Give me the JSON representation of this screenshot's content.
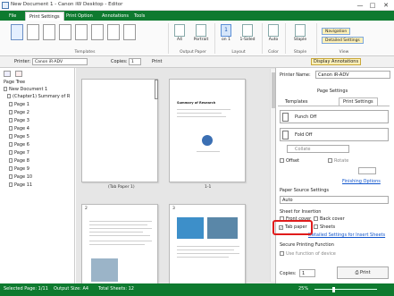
{
  "window": {
    "title": "New Document 1 - Canon iW Desktop - Editor",
    "minimize": "—",
    "maximize": "□",
    "close": "✕"
  },
  "tabs": [
    "File",
    "Print Settings",
    "Print Option",
    "Annotations",
    "Tools"
  ],
  "ribbon": {
    "groups": [
      "Templates",
      "Output Paper",
      "Layout",
      "Color",
      "Staple",
      "View"
    ],
    "paper_size": "A4",
    "orientation": "Portrait",
    "pages_per_sheet": "1",
    "pages_per_sheet_sub": "on 1",
    "sided": "1-Sided",
    "color": "Auto",
    "staple": "Staple",
    "navigation": "Navigation",
    "detailed_settings": "Detailed Settings"
  },
  "toolbar": {
    "printer_label": "Printer:",
    "printer_value": "Canon iR-ADV",
    "copies_label": "Copies:",
    "copies_value": "1",
    "print_label": "Print",
    "display_annotations": "Display Annotations"
  },
  "tree": {
    "title": "Page Tree",
    "root": "New Document 1",
    "chapter": "(Chapter1) Summary of R",
    "pages": [
      "Page 1",
      "Page 2",
      "Page 3",
      "Page 4",
      "Page 5",
      "Page 6",
      "Page 7",
      "Page 8",
      "Page 9",
      "Page 10",
      "Page 11"
    ]
  },
  "canvas": {
    "tab_paper_label": "(Tab Paper 1)",
    "page1_label": "1-1",
    "page2_number": "2",
    "page3_number": "3",
    "doc_title": "Summary of Research"
  },
  "settings": {
    "printer_name_label": "Printer Name:",
    "printer_name_value": "Canon iR-ADV",
    "section_title": "Page Settings",
    "tab_templates": "Templates",
    "tab_print_settings": "Print Settings",
    "punch": "Punch Off",
    "fold": "Fold Off",
    "collate": "Collate",
    "offset": "Offset",
    "rotate": "Rotate",
    "finishing_options": "Finishing Options",
    "paper_source_label": "Paper Source Settings",
    "paper_source_value": "Auto",
    "sheet_insertion": "Sheet for Insertion",
    "front_cover": "Front cover",
    "back_cover": "Back cover",
    "tab_paper": "Tab paper",
    "sheets": "Sheets",
    "detailed_insert": "Detailed Settings for Insert Sheets",
    "secure_printing": "Secure Printing Function",
    "use_device_function": "Use function of device",
    "copies_label": "Copies:",
    "copies_value": "1",
    "print_button": "Print"
  },
  "status": {
    "selected": "Selected Page: 1/11",
    "output_size": "Output Size: A4",
    "total_sheets": "Total Sheets: 12",
    "zoom": "25%"
  },
  "colors": {
    "accent_green": "#0e7a2f",
    "highlight_red": "#e01b1b"
  }
}
